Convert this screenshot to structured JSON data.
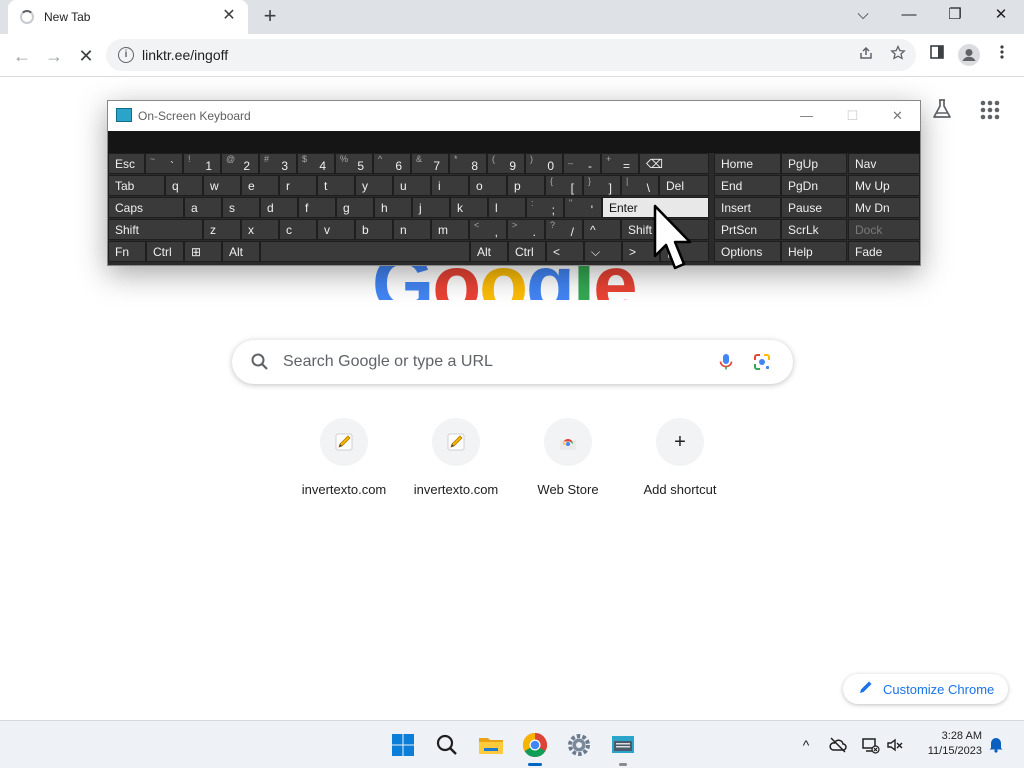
{
  "browser": {
    "tab": {
      "title": "New Tab",
      "close": "✕"
    },
    "new_tab": "+",
    "window_controls": {
      "dropdown": "⌵",
      "minimize": "—",
      "restore": "❐",
      "close": "✕"
    },
    "nav": {
      "back": "←",
      "forward": "→",
      "stop": "✕"
    },
    "omnibox": {
      "info": "i",
      "url": "linktr.ee/ingoff"
    }
  },
  "ntp": {
    "google_logo": [
      "G",
      "o",
      "o",
      "g",
      "l",
      "e"
    ],
    "logo_colors": [
      "#4285f4",
      "#ea4335",
      "#fbbc05",
      "#4285f4",
      "#34a853",
      "#ea4335"
    ],
    "search": {
      "placeholder": "Search Google or type a URL"
    },
    "shortcuts": [
      {
        "label": "invertexto.com",
        "icon": "pencil-note-icon"
      },
      {
        "label": "invertexto.com",
        "icon": "pencil-note-icon"
      },
      {
        "label": "Web Store",
        "icon": "web-store-icon"
      },
      {
        "label": "Add shortcut",
        "icon": "plus-icon",
        "glyph": "+"
      }
    ],
    "customize": {
      "label": "Customize Chrome"
    }
  },
  "osk": {
    "title": "On-Screen Keyboard",
    "controls": {
      "minimize": "—",
      "maximize": "☐",
      "close": "✕"
    },
    "rows": [
      [
        {
          "l": "Esc"
        },
        {
          "s": "~",
          "l": "`"
        },
        {
          "s": "!",
          "l": "1"
        },
        {
          "s": "@",
          "l": "2"
        },
        {
          "s": "#",
          "l": "3"
        },
        {
          "s": "$",
          "l": "4"
        },
        {
          "s": "%",
          "l": "5"
        },
        {
          "s": "^",
          "l": "6"
        },
        {
          "s": "&",
          "l": "7"
        },
        {
          "s": "*",
          "l": "8"
        },
        {
          "s": "(",
          "l": "9"
        },
        {
          "s": ")",
          "l": "0"
        },
        {
          "s": "_",
          "l": "-"
        },
        {
          "s": "+",
          "l": "="
        },
        {
          "l": "⌫"
        },
        {
          "l": "Home"
        },
        {
          "l": "PgUp"
        },
        {
          "l": "Nav"
        }
      ],
      [
        {
          "l": "Tab"
        },
        {
          "l": "q"
        },
        {
          "l": "w"
        },
        {
          "l": "e"
        },
        {
          "l": "r"
        },
        {
          "l": "t"
        },
        {
          "l": "y"
        },
        {
          "l": "u"
        },
        {
          "l": "i"
        },
        {
          "l": "o"
        },
        {
          "l": "p"
        },
        {
          "s": "{",
          "l": "["
        },
        {
          "s": "}",
          "l": "]"
        },
        {
          "s": "|",
          "l": "\\"
        },
        {
          "l": "Del"
        },
        {
          "l": "End"
        },
        {
          "l": "PgDn"
        },
        {
          "l": "Mv Up"
        }
      ],
      [
        {
          "l": "Caps"
        },
        {
          "l": "a"
        },
        {
          "l": "s"
        },
        {
          "l": "d"
        },
        {
          "l": "f"
        },
        {
          "l": "g"
        },
        {
          "l": "h"
        },
        {
          "l": "j"
        },
        {
          "l": "k"
        },
        {
          "l": "l"
        },
        {
          "s": ":",
          "l": ";"
        },
        {
          "s": "\"",
          "l": "'"
        },
        {
          "l": "Enter"
        },
        {
          "l": "Insert"
        },
        {
          "l": "Pause"
        },
        {
          "l": "Mv Dn"
        }
      ],
      [
        {
          "l": "Shift"
        },
        {
          "l": "z"
        },
        {
          "l": "x"
        },
        {
          "l": "c"
        },
        {
          "l": "v"
        },
        {
          "l": "b"
        },
        {
          "l": "n"
        },
        {
          "l": "m"
        },
        {
          "s": "<",
          "l": ","
        },
        {
          "s": ">",
          "l": "."
        },
        {
          "s": "?",
          "l": "/"
        },
        {
          "l": "^"
        },
        {
          "l": "Shift"
        },
        {
          "l": "PrtScn"
        },
        {
          "l": "ScrLk"
        },
        {
          "l": "Dock"
        }
      ],
      [
        {
          "l": "Fn"
        },
        {
          "l": "Ctrl"
        },
        {
          "l": "⊞"
        },
        {
          "l": "Alt"
        },
        {
          "l": ""
        },
        {
          "l": "Alt"
        },
        {
          "l": "Ctrl"
        },
        {
          "l": "<"
        },
        {
          "l": "⌵"
        },
        {
          "l": ">"
        },
        {
          "l": "▤"
        },
        {
          "l": "Options"
        },
        {
          "l": "Help"
        },
        {
          "l": "Fade"
        }
      ]
    ]
  },
  "taskbar": {
    "apps": [
      "windows-start-icon",
      "search-icon",
      "file-explorer-icon",
      "chrome-icon",
      "settings-icon",
      "osk-icon"
    ],
    "tray": {
      "chevron": "^",
      "time": "3:28 AM",
      "date": "11/15/2023"
    }
  }
}
